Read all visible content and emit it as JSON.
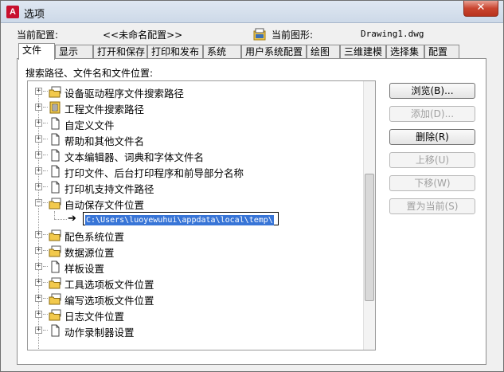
{
  "window": {
    "title": "选项",
    "app_icon_letter": "A",
    "close_label": "✕"
  },
  "info": {
    "profile_label": "当前配置:",
    "profile_value": "<<未命名配置>>",
    "drawing_label": "当前图形:",
    "drawing_value": "Drawing1.dwg"
  },
  "tabs": [
    {
      "label": "文件",
      "active": true
    },
    {
      "label": "显示"
    },
    {
      "label": "打开和保存"
    },
    {
      "label": "打印和发布"
    },
    {
      "label": "系统"
    },
    {
      "label": "用户系统配置"
    },
    {
      "label": "绘图"
    },
    {
      "label": "三维建模"
    },
    {
      "label": "选择集"
    },
    {
      "label": "配置"
    }
  ],
  "panel": {
    "label": "搜索路径、文件名和文件位置:"
  },
  "tree": {
    "items": [
      {
        "label": "设备驱动程序文件搜索路径",
        "icon": "folder-stack-icon",
        "expander": "+"
      },
      {
        "label": "工程文件搜索路径",
        "icon": "project-file-icon",
        "expander": "+"
      },
      {
        "label": "自定义文件",
        "icon": "document-icon",
        "expander": "+"
      },
      {
        "label": "帮助和其他文件名",
        "icon": "document-icon",
        "expander": "+"
      },
      {
        "label": "文本编辑器、词典和字体文件名",
        "icon": "document-icon",
        "expander": "+"
      },
      {
        "label": "打印文件、后台打印程序和前导部分名称",
        "icon": "document-icon",
        "expander": "+"
      },
      {
        "label": "打印机支持文件路径",
        "icon": "document-icon",
        "expander": "+"
      },
      {
        "label": "自动保存文件位置",
        "icon": "folder-stack-icon",
        "expander": "−"
      },
      {
        "label": "配色系统位置",
        "icon": "folder-stack-icon",
        "expander": "+"
      },
      {
        "label": "数据源位置",
        "icon": "folder-stack-icon",
        "expander": "+"
      },
      {
        "label": "样板设置",
        "icon": "document-icon",
        "expander": "+"
      },
      {
        "label": "工具选项板文件位置",
        "icon": "folder-stack-icon",
        "expander": "+"
      },
      {
        "label": "编写选项板文件位置",
        "icon": "folder-stack-icon",
        "expander": "+"
      },
      {
        "label": "日志文件位置",
        "icon": "folder-stack-icon",
        "expander": "+"
      },
      {
        "label": "动作录制器设置",
        "icon": "document-icon",
        "expander": "+"
      }
    ],
    "autosave_path": "C:\\Users\\luoyewuhui\\appdata\\local\\temp\\"
  },
  "buttons": {
    "browse": "浏览(B)...",
    "add": "添加(D)...",
    "remove": "删除(R)",
    "move_up": "上移(U)",
    "move_down": "下移(W)",
    "set_current": "置为当前(S)"
  },
  "colors": {
    "selection": "#3875d7",
    "folder": "#f2c94c",
    "close": "#c9452f"
  }
}
